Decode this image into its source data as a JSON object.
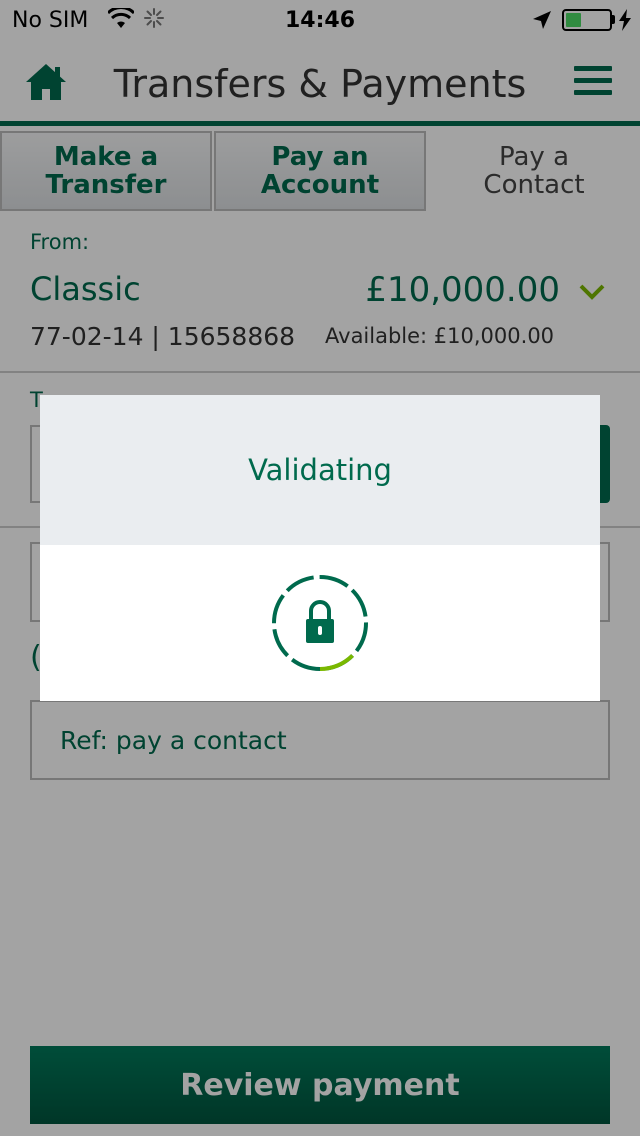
{
  "status_bar": {
    "carrier": "No SIM",
    "time": "14:46"
  },
  "header": {
    "title": "Transfers & Payments"
  },
  "tabs": [
    {
      "label": "Make a Transfer",
      "active": false
    },
    {
      "label": "Pay an Account",
      "active": false
    },
    {
      "label": "Pay a Contact",
      "active": true
    }
  ],
  "from": {
    "label": "From:",
    "account_name": "Classic",
    "balance": "£10,000.00",
    "sort_and_account": "77-02-14 | 15658868",
    "available": "Available:  £10,000.00"
  },
  "to": {
    "label": "T"
  },
  "reference": {
    "value": "Ref: pay a contact"
  },
  "review_button": {
    "label": "Review payment"
  },
  "modal": {
    "title": "Validating"
  },
  "colors": {
    "brand": "#006a4d",
    "accent": "#7ab800",
    "overlay": "rgba(0,0,0,0.36)"
  },
  "battery_level": 0.35
}
